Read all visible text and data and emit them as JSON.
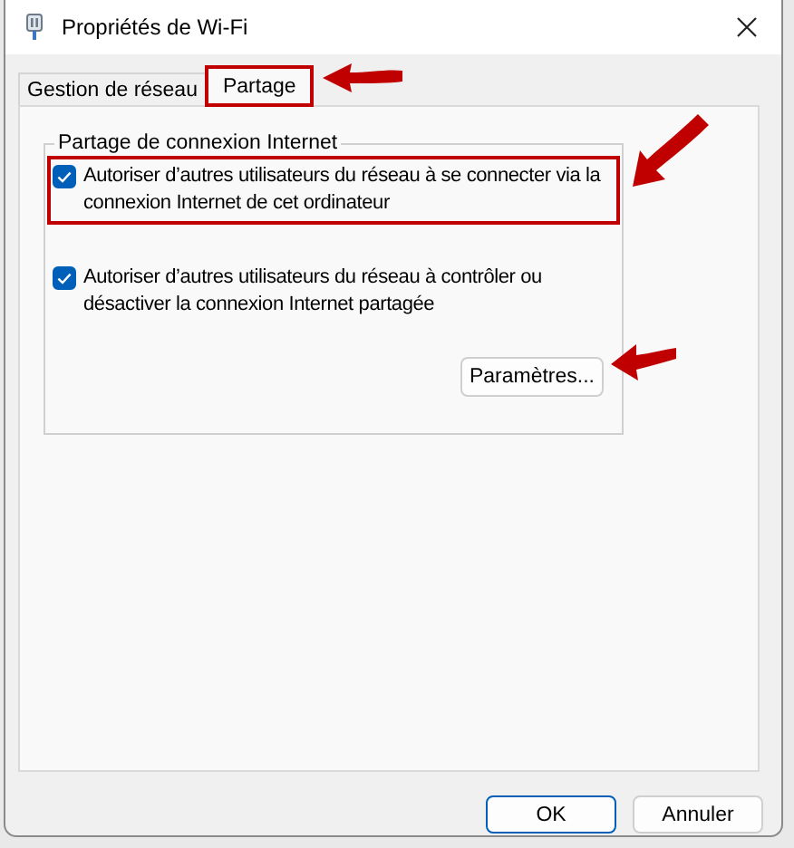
{
  "window": {
    "title": "Propriétés de Wi-Fi"
  },
  "tabs": [
    {
      "label": "Gestion de réseau",
      "selected": false,
      "boxed": false,
      "arrow": false
    },
    {
      "label": "Partage",
      "selected": true,
      "boxed": true,
      "arrow": true
    }
  ],
  "group": {
    "title": "Partage de connexion Internet",
    "options": [
      {
        "label": "Autoriser d’autres utilisateurs du réseau à se connecter via la connexion Internet de cet ordinateur",
        "checked": true,
        "boxed": true,
        "arrow": true
      },
      {
        "label": "Autoriser d’autres utilisateurs du réseau à contrôler ou désactiver la connexion Internet partagée",
        "checked": true,
        "boxed": false,
        "arrow": false
      }
    ],
    "settings_button": {
      "label": "Paramètres...",
      "arrow": true
    }
  },
  "buttons": [
    {
      "label": "OK",
      "default": true
    },
    {
      "label": "Annuler",
      "default": false
    }
  ]
}
